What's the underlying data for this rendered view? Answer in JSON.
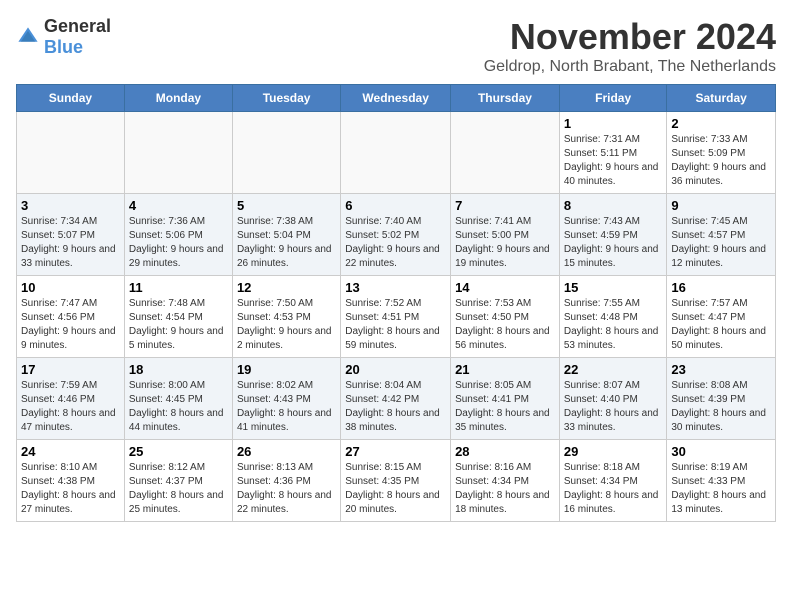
{
  "logo": {
    "general": "General",
    "blue": "Blue"
  },
  "title": "November 2024",
  "subtitle": "Geldrop, North Brabant, The Netherlands",
  "days_of_week": [
    "Sunday",
    "Monday",
    "Tuesday",
    "Wednesday",
    "Thursday",
    "Friday",
    "Saturday"
  ],
  "weeks": [
    [
      {
        "day": "",
        "info": ""
      },
      {
        "day": "",
        "info": ""
      },
      {
        "day": "",
        "info": ""
      },
      {
        "day": "",
        "info": ""
      },
      {
        "day": "",
        "info": ""
      },
      {
        "day": "1",
        "info": "Sunrise: 7:31 AM\nSunset: 5:11 PM\nDaylight: 9 hours and 40 minutes."
      },
      {
        "day": "2",
        "info": "Sunrise: 7:33 AM\nSunset: 5:09 PM\nDaylight: 9 hours and 36 minutes."
      }
    ],
    [
      {
        "day": "3",
        "info": "Sunrise: 7:34 AM\nSunset: 5:07 PM\nDaylight: 9 hours and 33 minutes."
      },
      {
        "day": "4",
        "info": "Sunrise: 7:36 AM\nSunset: 5:06 PM\nDaylight: 9 hours and 29 minutes."
      },
      {
        "day": "5",
        "info": "Sunrise: 7:38 AM\nSunset: 5:04 PM\nDaylight: 9 hours and 26 minutes."
      },
      {
        "day": "6",
        "info": "Sunrise: 7:40 AM\nSunset: 5:02 PM\nDaylight: 9 hours and 22 minutes."
      },
      {
        "day": "7",
        "info": "Sunrise: 7:41 AM\nSunset: 5:00 PM\nDaylight: 9 hours and 19 minutes."
      },
      {
        "day": "8",
        "info": "Sunrise: 7:43 AM\nSunset: 4:59 PM\nDaylight: 9 hours and 15 minutes."
      },
      {
        "day": "9",
        "info": "Sunrise: 7:45 AM\nSunset: 4:57 PM\nDaylight: 9 hours and 12 minutes."
      }
    ],
    [
      {
        "day": "10",
        "info": "Sunrise: 7:47 AM\nSunset: 4:56 PM\nDaylight: 9 hours and 9 minutes."
      },
      {
        "day": "11",
        "info": "Sunrise: 7:48 AM\nSunset: 4:54 PM\nDaylight: 9 hours and 5 minutes."
      },
      {
        "day": "12",
        "info": "Sunrise: 7:50 AM\nSunset: 4:53 PM\nDaylight: 9 hours and 2 minutes."
      },
      {
        "day": "13",
        "info": "Sunrise: 7:52 AM\nSunset: 4:51 PM\nDaylight: 8 hours and 59 minutes."
      },
      {
        "day": "14",
        "info": "Sunrise: 7:53 AM\nSunset: 4:50 PM\nDaylight: 8 hours and 56 minutes."
      },
      {
        "day": "15",
        "info": "Sunrise: 7:55 AM\nSunset: 4:48 PM\nDaylight: 8 hours and 53 minutes."
      },
      {
        "day": "16",
        "info": "Sunrise: 7:57 AM\nSunset: 4:47 PM\nDaylight: 8 hours and 50 minutes."
      }
    ],
    [
      {
        "day": "17",
        "info": "Sunrise: 7:59 AM\nSunset: 4:46 PM\nDaylight: 8 hours and 47 minutes."
      },
      {
        "day": "18",
        "info": "Sunrise: 8:00 AM\nSunset: 4:45 PM\nDaylight: 8 hours and 44 minutes."
      },
      {
        "day": "19",
        "info": "Sunrise: 8:02 AM\nSunset: 4:43 PM\nDaylight: 8 hours and 41 minutes."
      },
      {
        "day": "20",
        "info": "Sunrise: 8:04 AM\nSunset: 4:42 PM\nDaylight: 8 hours and 38 minutes."
      },
      {
        "day": "21",
        "info": "Sunrise: 8:05 AM\nSunset: 4:41 PM\nDaylight: 8 hours and 35 minutes."
      },
      {
        "day": "22",
        "info": "Sunrise: 8:07 AM\nSunset: 4:40 PM\nDaylight: 8 hours and 33 minutes."
      },
      {
        "day": "23",
        "info": "Sunrise: 8:08 AM\nSunset: 4:39 PM\nDaylight: 8 hours and 30 minutes."
      }
    ],
    [
      {
        "day": "24",
        "info": "Sunrise: 8:10 AM\nSunset: 4:38 PM\nDaylight: 8 hours and 27 minutes."
      },
      {
        "day": "25",
        "info": "Sunrise: 8:12 AM\nSunset: 4:37 PM\nDaylight: 8 hours and 25 minutes."
      },
      {
        "day": "26",
        "info": "Sunrise: 8:13 AM\nSunset: 4:36 PM\nDaylight: 8 hours and 22 minutes."
      },
      {
        "day": "27",
        "info": "Sunrise: 8:15 AM\nSunset: 4:35 PM\nDaylight: 8 hours and 20 minutes."
      },
      {
        "day": "28",
        "info": "Sunrise: 8:16 AM\nSunset: 4:34 PM\nDaylight: 8 hours and 18 minutes."
      },
      {
        "day": "29",
        "info": "Sunrise: 8:18 AM\nSunset: 4:34 PM\nDaylight: 8 hours and 16 minutes."
      },
      {
        "day": "30",
        "info": "Sunrise: 8:19 AM\nSunset: 4:33 PM\nDaylight: 8 hours and 13 minutes."
      }
    ]
  ]
}
